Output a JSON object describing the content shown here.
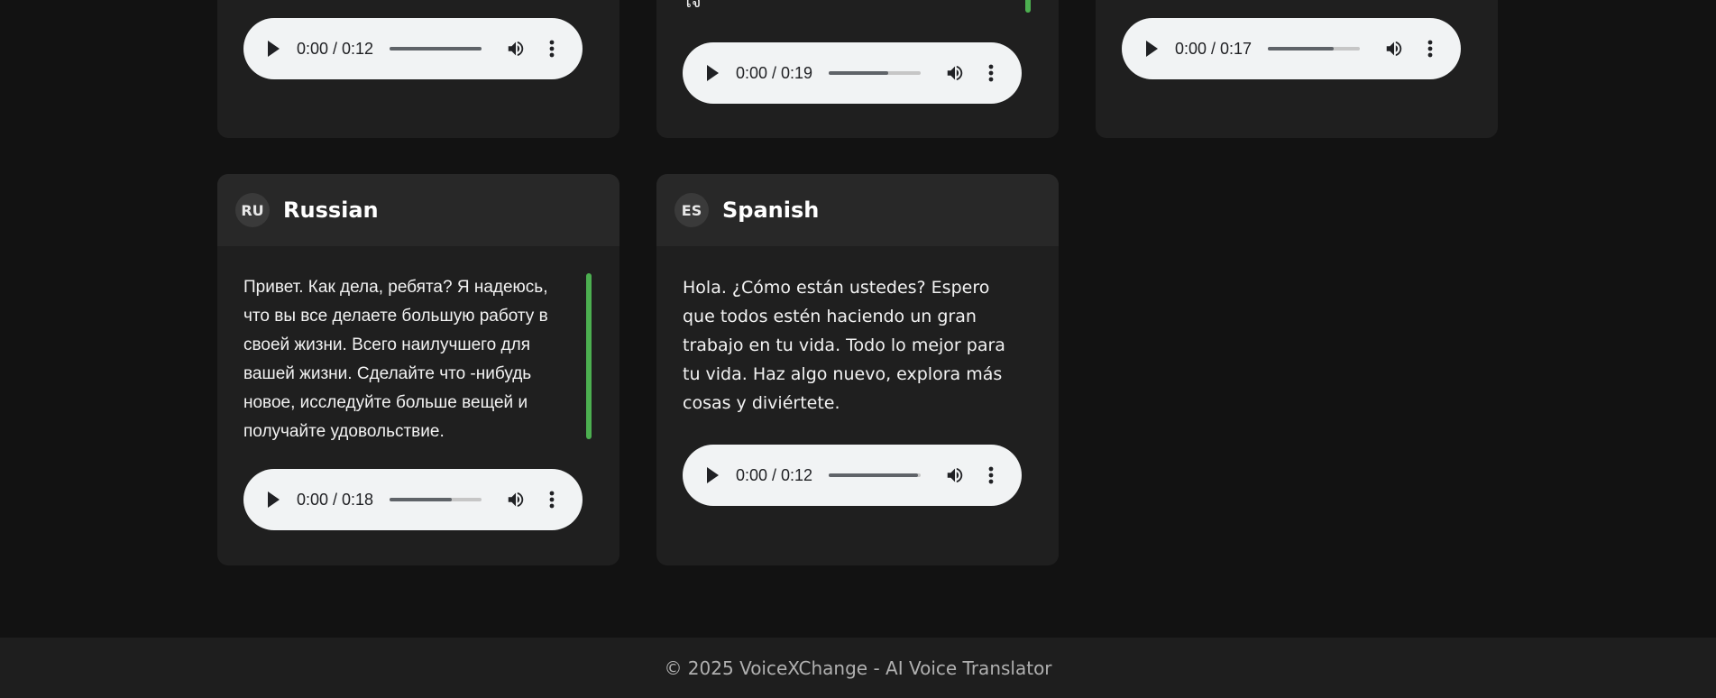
{
  "cards": [
    {
      "id": "card-top-1",
      "player": {
        "time": "0:00 / 0:12",
        "progress": 1.0
      }
    },
    {
      "id": "card-top-2",
      "partial_text": "ใจ",
      "player": {
        "time": "0:00 / 0:19",
        "progress": 0.65
      }
    },
    {
      "id": "card-top-3",
      "player": {
        "time": "0:00 / 0:17",
        "progress": 0.72
      }
    },
    {
      "id": "card-russian",
      "code": "RU",
      "language": "Russian",
      "text": "Привет. Как дела, ребята? Я надеюсь, что вы все делаете большую работу в своей жизни. Всего наилучшего для вашей жизни. Сделайте что -нибудь новое, исследуйте больше вещей и получайте удовольствие.",
      "player": {
        "time": "0:00 / 0:18",
        "progress": 0.68
      }
    },
    {
      "id": "card-spanish",
      "code": "ES",
      "language": "Spanish",
      "text": "Hola. ¿Cómo están ustedes? Espero que todos estén haciendo un gran trabajo en tu vida. Todo lo mejor para tu vida. Haz algo nuevo, explora más cosas y diviértete.",
      "player": {
        "time": "0:00 / 0:12",
        "progress": 0.97
      }
    }
  ],
  "footer": {
    "text": "© 2025 VoiceXChange - AI Voice Translator"
  },
  "colors": {
    "accent": "#4caf50",
    "background": "#121212",
    "card": "#1f1f1f",
    "card_header": "#282828"
  },
  "icons": [
    "play-icon",
    "volume-icon",
    "more-options-icon"
  ]
}
